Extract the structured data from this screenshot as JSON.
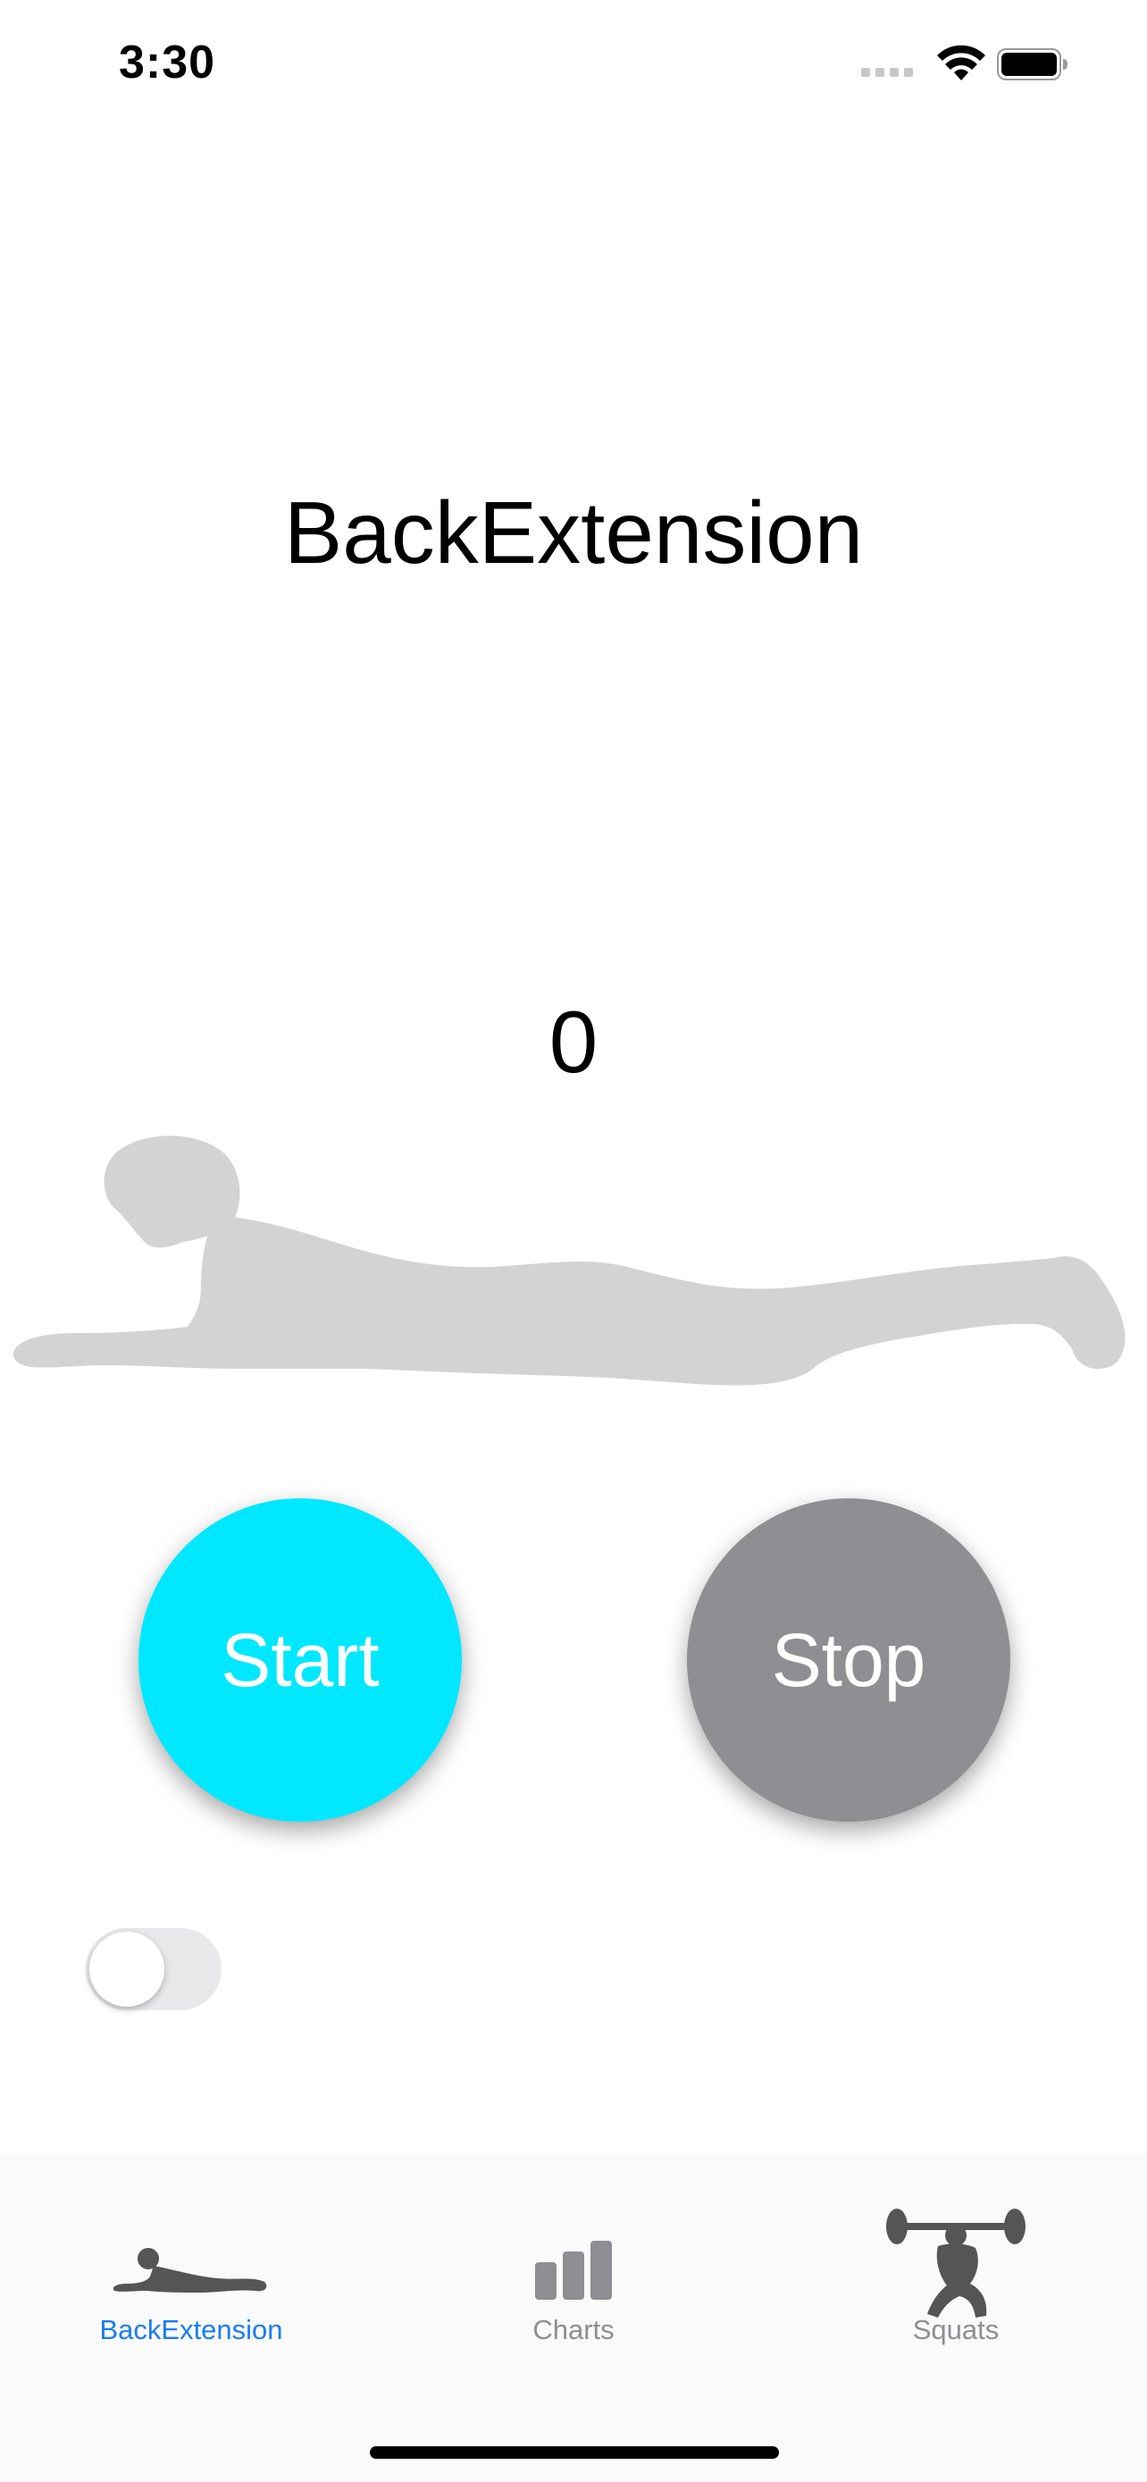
{
  "status_bar": {
    "time": "3:30"
  },
  "main": {
    "title": "BackExtension",
    "rep_count": "0",
    "start_label": "Start",
    "stop_label": "Stop",
    "toggle_on": false
  },
  "tab_bar": {
    "tabs": [
      {
        "label": "BackExtension",
        "icon": "back-extension-icon",
        "active": true
      },
      {
        "label": "Charts",
        "icon": "bar-chart-icon",
        "active": false
      },
      {
        "label": "Squats",
        "icon": "squat-icon",
        "active": false
      }
    ]
  },
  "colors": {
    "start_button": "#00e8ff",
    "stop_button": "#8e8e93",
    "active_tab": "#1a7cf5",
    "inactive_tab": "#8e8e93",
    "illustration": "#d3d3d3"
  }
}
